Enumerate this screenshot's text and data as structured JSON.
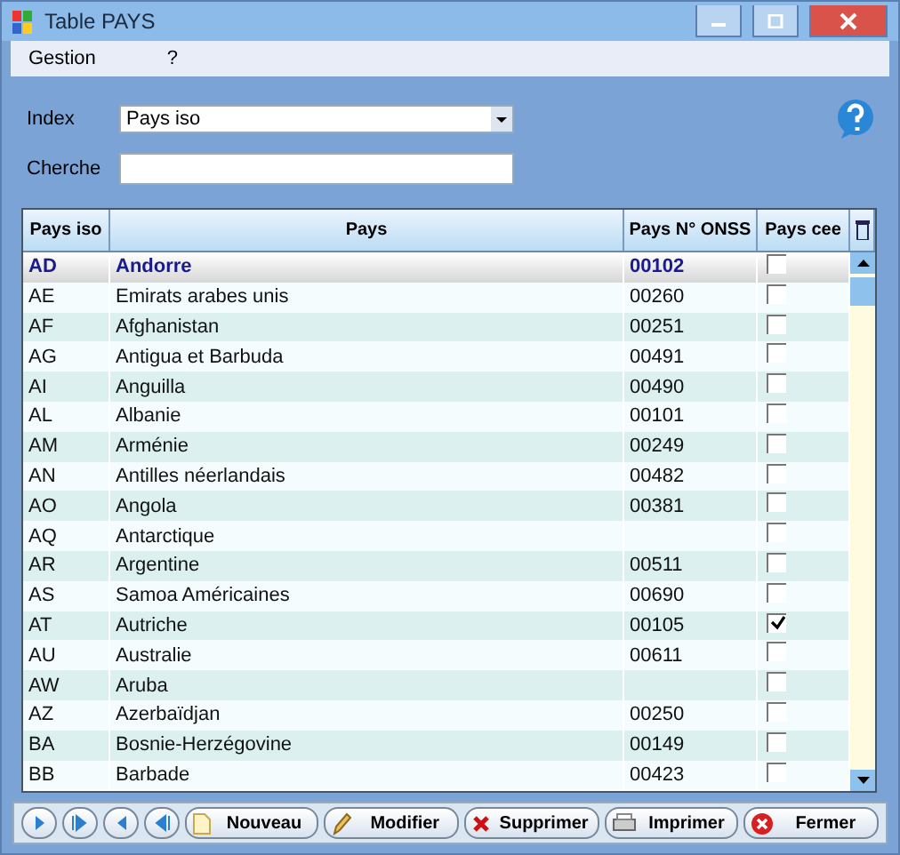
{
  "window": {
    "title": "Table PAYS"
  },
  "menu": [
    {
      "label": "Gestion"
    },
    {
      "label": "?"
    }
  ],
  "form": {
    "index_label": "Index",
    "index_value": "Pays iso",
    "search_label": "Cherche"
  },
  "table": {
    "columns": [
      "Pays iso",
      "Pays",
      "Pays N° ONSS",
      "Pays cee"
    ],
    "rows": [
      {
        "iso": "AD",
        "pays": "Andorre",
        "onss": "00102",
        "cee": false,
        "selected": true
      },
      {
        "iso": "AE",
        "pays": "Emirats arabes unis",
        "onss": "00260",
        "cee": false,
        "selected": false
      },
      {
        "iso": "AF",
        "pays": "Afghanistan",
        "onss": "00251",
        "cee": false,
        "selected": false
      },
      {
        "iso": "AG",
        "pays": "Antigua et Barbuda",
        "onss": "00491",
        "cee": false,
        "selected": false
      },
      {
        "iso": "AI",
        "pays": "Anguilla",
        "onss": "00490",
        "cee": false,
        "selected": false
      },
      {
        "iso": "AL",
        "pays": "Albanie",
        "onss": "00101",
        "cee": false,
        "selected": false
      },
      {
        "iso": "AM",
        "pays": "Arménie",
        "onss": "00249",
        "cee": false,
        "selected": false
      },
      {
        "iso": "AN",
        "pays": "Antilles néerlandais",
        "onss": "00482",
        "cee": false,
        "selected": false
      },
      {
        "iso": "AO",
        "pays": "Angola",
        "onss": "00381",
        "cee": false,
        "selected": false
      },
      {
        "iso": "AQ",
        "pays": "Antarctique",
        "onss": "",
        "cee": false,
        "selected": false
      },
      {
        "iso": "AR",
        "pays": "Argentine",
        "onss": "00511",
        "cee": false,
        "selected": false
      },
      {
        "iso": "AS",
        "pays": "Samoa Américaines",
        "onss": "00690",
        "cee": false,
        "selected": false
      },
      {
        "iso": "AT",
        "pays": "Autriche",
        "onss": "00105",
        "cee": true,
        "selected": false
      },
      {
        "iso": "AU",
        "pays": "Australie",
        "onss": "00611",
        "cee": false,
        "selected": false
      },
      {
        "iso": "AW",
        "pays": "Aruba",
        "onss": "",
        "cee": false,
        "selected": false
      },
      {
        "iso": "AZ",
        "pays": "Azerbaïdjan",
        "onss": "00250",
        "cee": false,
        "selected": false
      },
      {
        "iso": "BA",
        "pays": "Bosnie-Herzégovine",
        "onss": "00149",
        "cee": false,
        "selected": false
      },
      {
        "iso": "BB",
        "pays": "Barbade",
        "onss": "00423",
        "cee": false,
        "selected": false
      }
    ]
  },
  "buttons": [
    {
      "kind": "new",
      "label": "Nouveau"
    },
    {
      "kind": "edit",
      "label": "Modifier"
    },
    {
      "kind": "delete",
      "label": "Supprimer"
    },
    {
      "kind": "print",
      "label": "Imprimer"
    },
    {
      "kind": "close",
      "label": "Fermer"
    }
  ]
}
